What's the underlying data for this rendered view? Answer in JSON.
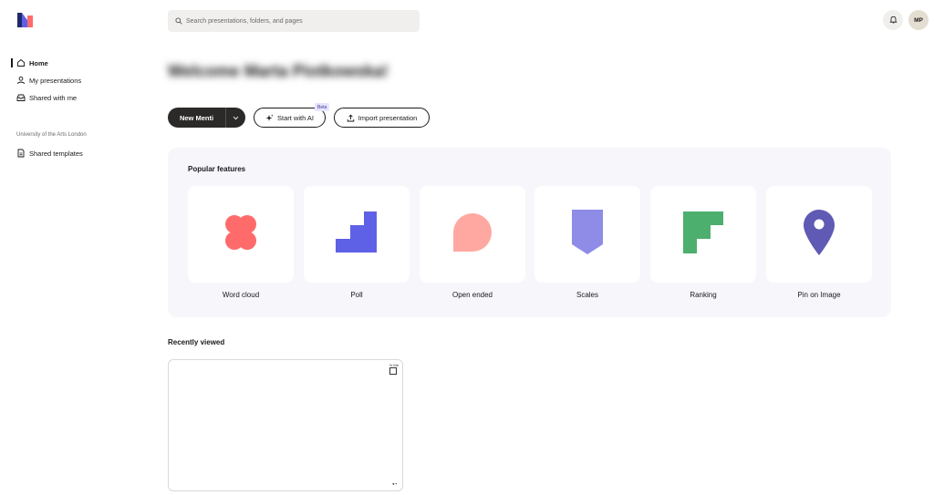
{
  "colors": {
    "accent_dark": "#2b2a28",
    "word_cloud": "#ff6b6b",
    "poll": "#5e61e6",
    "open_ended": "#ffa8a1",
    "scales": "#8e8ce6",
    "ranking": "#4caf6e",
    "pin_on_image": "#5f5ab3"
  },
  "sidebar": {
    "items": [
      {
        "label": "Home",
        "icon": "home-icon"
      },
      {
        "label": "My presentations",
        "icon": "user-icon"
      },
      {
        "label": "Shared with me",
        "icon": "inbox-icon"
      }
    ],
    "org_label": "University of the Arts London",
    "org_items": [
      {
        "label": "Shared templates",
        "icon": "template-icon"
      }
    ]
  },
  "search": {
    "placeholder": "Search presentations, folders, and pages"
  },
  "user": {
    "initials": "MP"
  },
  "welcome": {
    "text": "Welcome Marta Piotkowska!"
  },
  "actions": {
    "new_menti": "New Menti",
    "start_ai": "Start with AI",
    "beta_badge": "Beta",
    "import": "Import presentation"
  },
  "popular": {
    "title": "Popular features",
    "features": [
      {
        "label": "Word cloud",
        "icon": "word-cloud-icon"
      },
      {
        "label": "Poll",
        "icon": "poll-icon"
      },
      {
        "label": "Open ended",
        "icon": "open-ended-icon"
      },
      {
        "label": "Scales",
        "icon": "scales-icon"
      },
      {
        "label": "Ranking",
        "icon": "ranking-icon"
      },
      {
        "label": "Pin on Image",
        "icon": "pin-icon"
      }
    ]
  },
  "recent": {
    "title": "Recently viewed",
    "card_corner": "% Me"
  }
}
